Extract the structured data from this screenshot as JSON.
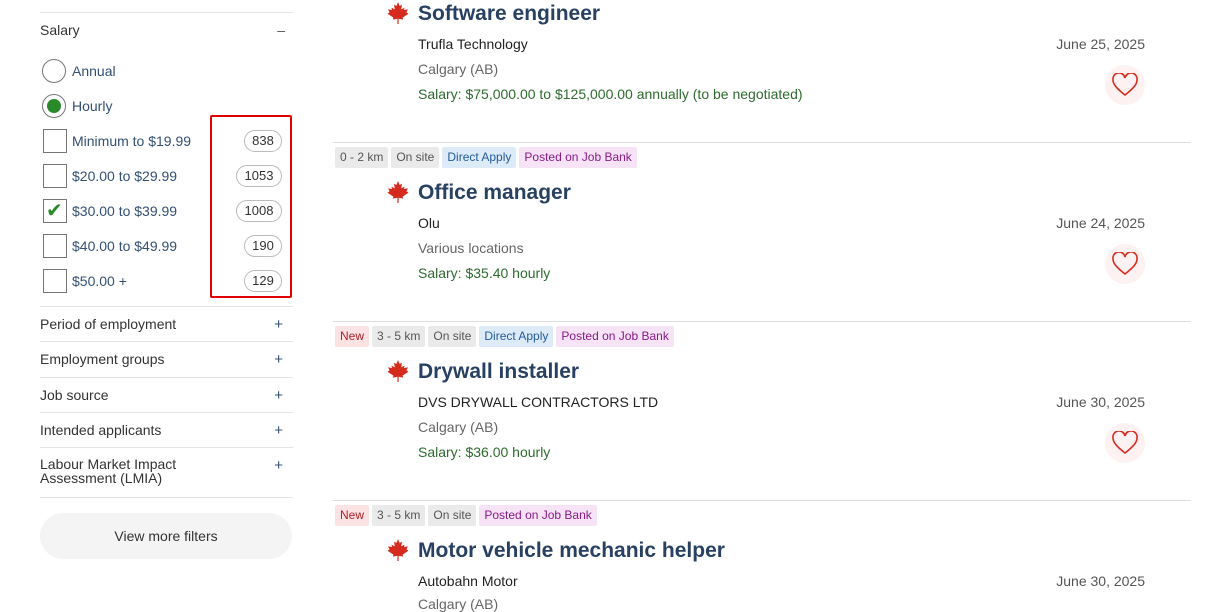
{
  "sidebar": {
    "salary_filter": {
      "title": "Salary",
      "toggle": "–",
      "radio_options": [
        {
          "label": "Annual",
          "checked": false
        },
        {
          "label": "Hourly",
          "checked": true
        }
      ],
      "ranges": [
        {
          "label": "Minimum to $19.99",
          "count": "838",
          "checked": false
        },
        {
          "label": "$20.00 to $29.99",
          "count": "1053",
          "checked": false
        },
        {
          "label": "$30.00 to $39.99",
          "count": "1008",
          "checked": true
        },
        {
          "label": "$40.00 to $49.99",
          "count": "190",
          "checked": false
        },
        {
          "label": "$50.00 +",
          "count": "129",
          "checked": false
        }
      ]
    },
    "filters": [
      {
        "label": "Period of employment",
        "toggle": "+"
      },
      {
        "label": "Employment groups",
        "toggle": "+"
      },
      {
        "label": "Job source",
        "toggle": "+"
      },
      {
        "label": "Intended applicants",
        "toggle": "+"
      },
      {
        "label": "Labour Market Impact Assessment (LMIA)",
        "toggle": "+"
      }
    ],
    "view_more_label": "View more filters"
  },
  "jobs": [
    {
      "tags": [],
      "title": "Software engineer",
      "employer": "Trufla Technology",
      "location": "Calgary (AB)",
      "salary": "Salary: $75,000.00 to $125,000.00 annually (to be negotiated)",
      "date": "June 25, 2025"
    },
    {
      "tags": [
        {
          "label": "0 - 2 km",
          "kind": "plain"
        },
        {
          "label": "On site",
          "kind": "plain"
        },
        {
          "label": "Direct Apply",
          "kind": "direct"
        },
        {
          "label": "Posted on Job Bank",
          "kind": "jobbank"
        }
      ],
      "title": "Office manager",
      "employer": "Olu",
      "location": "Various locations",
      "salary": "Salary: $35.40 hourly",
      "date": "June 24, 2025"
    },
    {
      "tags": [
        {
          "label": "New",
          "kind": "new"
        },
        {
          "label": "3 - 5 km",
          "kind": "plain"
        },
        {
          "label": "On site",
          "kind": "plain"
        },
        {
          "label": "Direct Apply",
          "kind": "direct"
        },
        {
          "label": "Posted on Job Bank",
          "kind": "jobbank"
        }
      ],
      "title": "Drywall installer",
      "employer": "DVS DRYWALL CONTRACTORS LTD",
      "location": "Calgary (AB)",
      "salary": "Salary: $36.00 hourly",
      "date": "June 30, 2025"
    },
    {
      "tags": [
        {
          "label": "New",
          "kind": "new"
        },
        {
          "label": "3 - 5 km",
          "kind": "plain"
        },
        {
          "label": "On site",
          "kind": "plain"
        },
        {
          "label": "Posted on Job Bank",
          "kind": "jobbank"
        }
      ],
      "title": "Motor vehicle mechanic helper",
      "employer": "Autobahn Motor",
      "location": "Calgary (AB)",
      "salary": "",
      "date": "June 30, 2025"
    }
  ],
  "colors": {
    "accent_link": "#335075",
    "title": "#284162",
    "salary_text": "#2e6b2e",
    "highlight": "#e00000",
    "check_green": "#2a8a2a",
    "maple_leaf": "#d52b1e"
  },
  "icons": {
    "job_flag": "maple-leaf-icon",
    "favorite": "heart-icon",
    "checked": "checkmark-icon"
  }
}
